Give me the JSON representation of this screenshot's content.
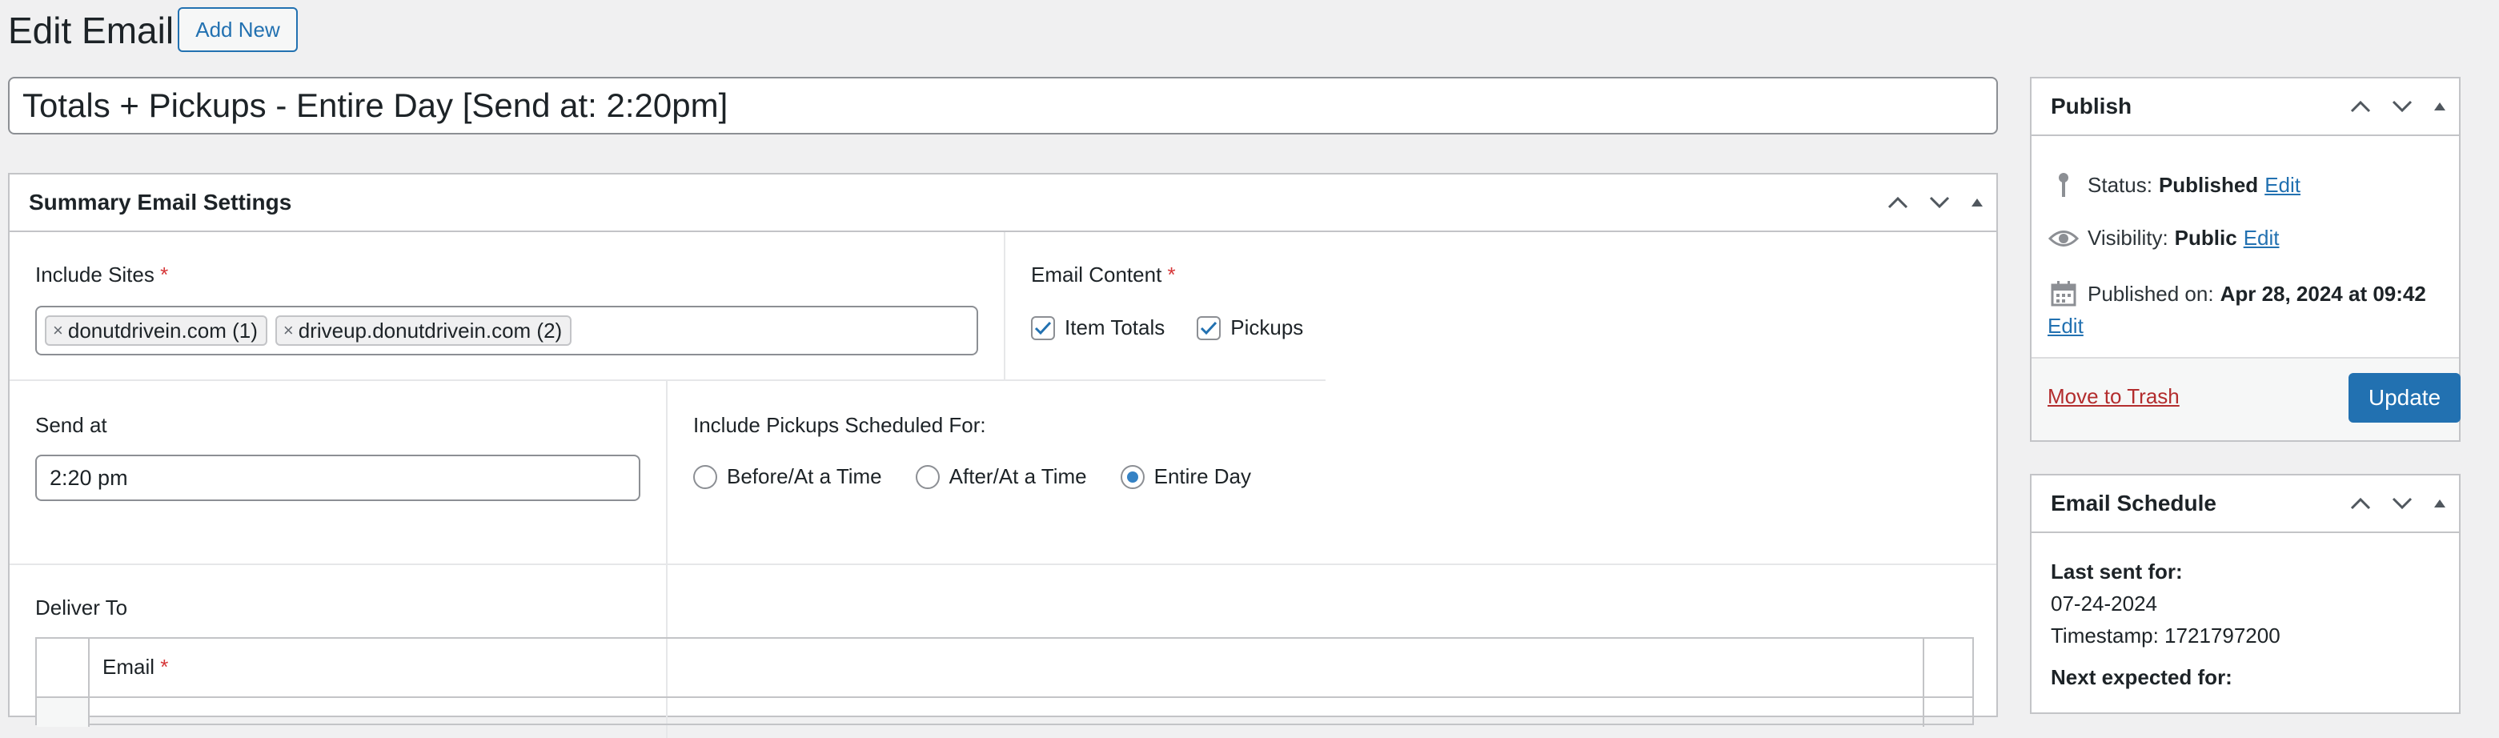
{
  "header": {
    "title": "Edit Email",
    "add_new_label": "Add New"
  },
  "post_title": "Totals + Pickups - Entire Day [Send at: 2:20pm]",
  "summary_box": {
    "title": "Summary Email Settings",
    "include_sites": {
      "label": "Include Sites",
      "required_mark": "*",
      "selected": [
        {
          "remove": "×",
          "label": "donutdrivein.com (1)"
        },
        {
          "remove": "×",
          "label": "driveup.donutdrivein.com (2)"
        }
      ]
    },
    "email_content": {
      "label": "Email Content",
      "required_mark": "*",
      "options": [
        {
          "label": "Item Totals",
          "checked": true
        },
        {
          "label": "Pickups",
          "checked": true
        }
      ]
    },
    "send_at": {
      "label": "Send at",
      "value": "2:20 pm"
    },
    "pickups_scheduled": {
      "label": "Include Pickups Scheduled For:",
      "options": [
        {
          "label": "Before/At a Time",
          "selected": false
        },
        {
          "label": "After/At a Time",
          "selected": false
        },
        {
          "label": "Entire Day",
          "selected": true
        }
      ]
    },
    "deliver_to": {
      "label": "Deliver To",
      "columns": [
        "Email"
      ],
      "required_mark": "*"
    }
  },
  "publish_box": {
    "title": "Publish",
    "status_label": "Status:",
    "status_value": "Published",
    "visibility_label": "Visibility:",
    "visibility_value": "Public",
    "published_on_label": "Published on:",
    "published_on_value": "Apr 28, 2024 at 09:42",
    "edit_label": "Edit",
    "trash_label": "Move to Trash",
    "update_label": "Update"
  },
  "schedule_box": {
    "title": "Email Schedule",
    "last_sent_label": "Last sent for:",
    "last_sent_date": "07-24-2024",
    "timestamp_text": "Timestamp: 1721797200",
    "next_expected_label": "Next expected for:"
  },
  "colors": {
    "accent": "#2271b1",
    "update_button": "#2271b1",
    "trash_link": "#b32d2e",
    "required": "#d63638"
  }
}
